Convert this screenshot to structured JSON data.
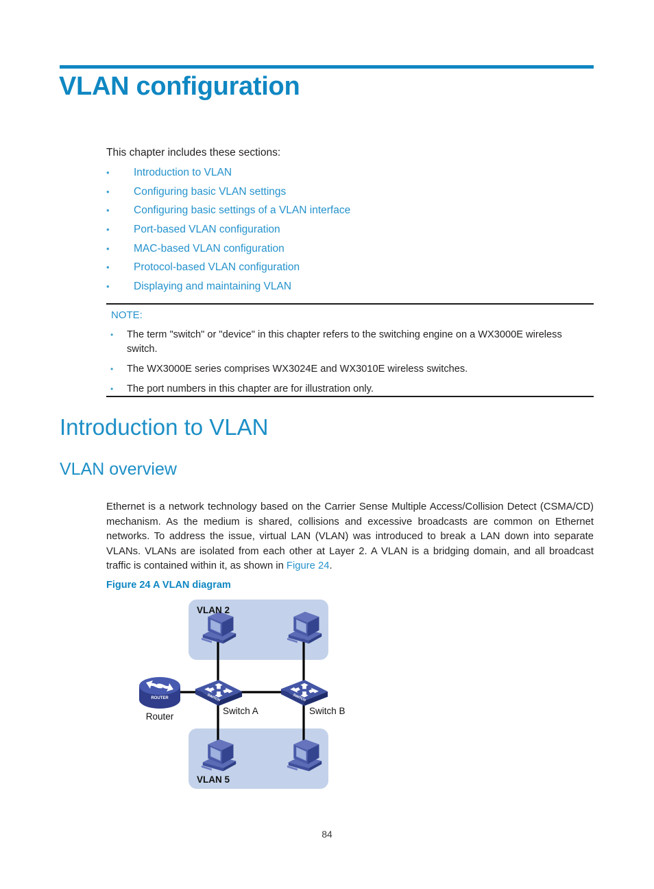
{
  "document": {
    "title": "VLAN configuration",
    "page_number": "84",
    "accent_color": "#0f87c2",
    "link_color": "#2492cc",
    "text_color": "#231f20"
  },
  "intro": {
    "line": "This chapter includes these sections:"
  },
  "toc": {
    "bullet": "•",
    "items": [
      {
        "label": "Introduction to VLAN"
      },
      {
        "label": "Configuring basic VLAN settings"
      },
      {
        "label": "Configuring basic settings of a VLAN interface"
      },
      {
        "label": "Port-based VLAN configuration"
      },
      {
        "label": "MAC-based VLAN configuration"
      },
      {
        "label": "Protocol-based VLAN configuration"
      },
      {
        "label": "Displaying and maintaining VLAN"
      }
    ]
  },
  "note": {
    "label": "NOTE:",
    "bullet": "•",
    "items": [
      {
        "text": "The term \"switch\" or \"device\" in this chapter refers to the switching engine on a WX3000E wireless switch."
      },
      {
        "text": "The WX3000E series comprises WX3024E and WX3010E wireless switches."
      },
      {
        "text": "The port numbers in this chapter are for illustration only."
      }
    ]
  },
  "headings": {
    "h1": "Introduction to VLAN",
    "h2": "VLAN overview"
  },
  "body": {
    "paragraph_before_link": "Ethernet is a network technology based on the Carrier Sense Multiple Access/Collision Detect (CSMA/CD) mechanism. As the medium is shared, collisions and excessive broadcasts are common on Ethernet networks. To address the issue, virtual LAN (VLAN) was introduced to break a LAN down into separate VLANs. VLANs are isolated from each other at Layer 2. A VLAN is a bridging domain, and all broadcast traffic is contained within it, as shown in ",
    "link_text": "Figure 24",
    "paragraph_after_link": "."
  },
  "figure": {
    "caption": "Figure 24 A VLAN diagram",
    "vlan_box_color": "#c3d2ea",
    "device_color": "#3c4f9e",
    "link_color": "#000000",
    "zones": [
      {
        "name": "VLAN 2",
        "label": "VLAN 2",
        "position": "top"
      },
      {
        "name": "VLAN 5",
        "label": "VLAN 5",
        "position": "bottom"
      }
    ],
    "devices": [
      {
        "type": "router",
        "label": "Router",
        "badge": "ROUTER"
      },
      {
        "type": "switch",
        "label": "Switch A",
        "badge": "SWITCH"
      },
      {
        "type": "switch",
        "label": "Switch B",
        "badge": "SWITCH"
      },
      {
        "type": "pc",
        "label": "",
        "zone": "VLAN 2",
        "side": "left"
      },
      {
        "type": "pc",
        "label": "",
        "zone": "VLAN 2",
        "side": "right"
      },
      {
        "type": "pc",
        "label": "",
        "zone": "VLAN 5",
        "side": "left"
      },
      {
        "type": "pc",
        "label": "",
        "zone": "VLAN 5",
        "side": "right"
      }
    ],
    "connections": [
      {
        "from": "Router",
        "to": "Switch A"
      },
      {
        "from": "Switch A",
        "to": "Switch B"
      },
      {
        "from": "Switch A",
        "to": "VLAN 2 left PC"
      },
      {
        "from": "Switch A",
        "to": "VLAN 5 left PC"
      },
      {
        "from": "Switch B",
        "to": "VLAN 2 right PC"
      },
      {
        "from": "Switch B",
        "to": "VLAN 5 right PC"
      }
    ]
  }
}
